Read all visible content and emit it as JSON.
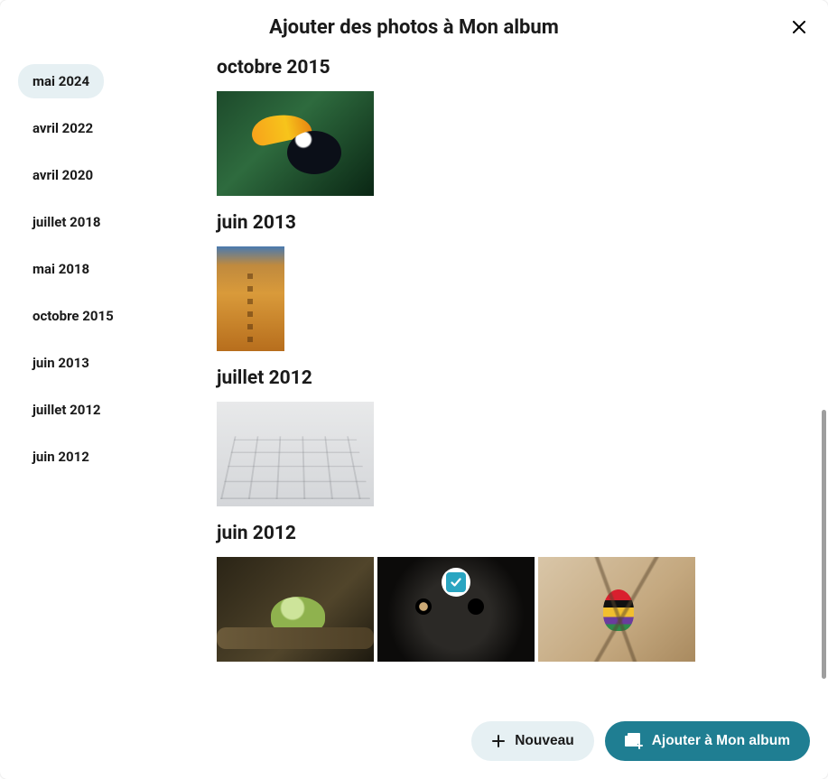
{
  "header": {
    "title": "Ajouter des photos à Mon album"
  },
  "sidebar": {
    "items": [
      {
        "label": "mai 2024",
        "active": true
      },
      {
        "label": "avril 2022",
        "active": false
      },
      {
        "label": "avril 2020",
        "active": false
      },
      {
        "label": "juillet 2018",
        "active": false
      },
      {
        "label": "mai 2018",
        "active": false
      },
      {
        "label": "octobre 2015",
        "active": false
      },
      {
        "label": "juin 2013",
        "active": false
      },
      {
        "label": "juillet 2012",
        "active": false
      },
      {
        "label": "juin 2012",
        "active": false
      }
    ]
  },
  "groups": [
    {
      "title": "octobre 2015"
    },
    {
      "title": "juin 2013"
    },
    {
      "title": "juillet 2012"
    },
    {
      "title": "juin 2012"
    }
  ],
  "footer": {
    "new_label": "Nouveau",
    "add_label": "Ajouter à Mon album"
  }
}
